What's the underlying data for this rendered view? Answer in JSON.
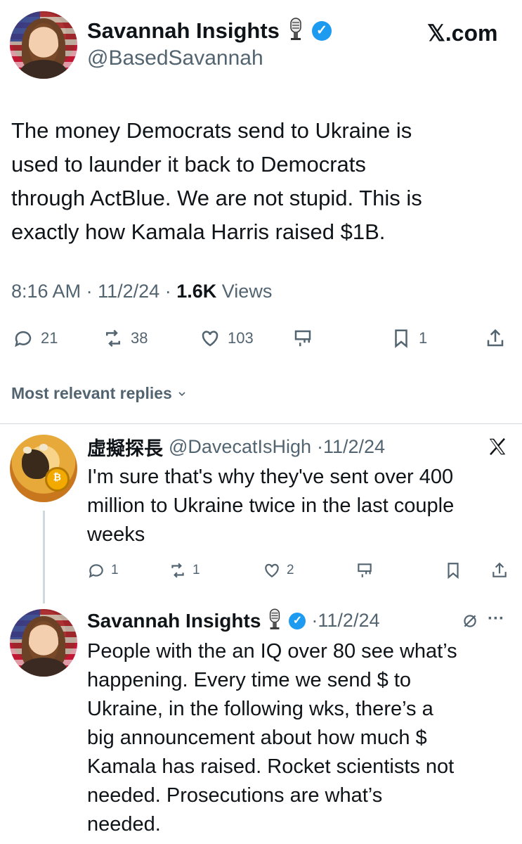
{
  "brand": {
    "label": "𝕏.com"
  },
  "main_tweet": {
    "author": {
      "display_name": "Savannah Insights",
      "handle": "@BasedSavannah",
      "verified_icon": "verified-badge-icon",
      "emoji_icon": "microphone-icon"
    },
    "text_lines": [
      "The money Democrats send to Ukraine is",
      "used to launder it back to Democrats",
      "through ActBlue. We are not stupid. This is",
      "exactly how Kamala Harris raised $1B."
    ],
    "time": "8:16 AM",
    "date": "11/2/24",
    "views_count": "1.6K",
    "views_label": "Views",
    "sep": "·",
    "actions": {
      "replies": "21",
      "reposts": "38",
      "likes": "103",
      "bookmarks": "1"
    }
  },
  "replies_section": {
    "label": "Most relevant replies",
    "chevron_icon": "chevron-down-icon"
  },
  "reply_1": {
    "display_name": "虛擬探長",
    "handle": "@DavecatIsHigh",
    "date": "·11/2/24",
    "platform_icon": "x-logo-icon",
    "text_lines": [
      "I'm sure that's why they've sent over 400",
      "million to Ukraine twice in the last couple",
      "weeks"
    ],
    "actions": {
      "replies": "1",
      "reposts": "1",
      "likes": "2"
    }
  },
  "reply_2": {
    "display_name": "Savannah Insights",
    "date": "·11/2/24",
    "more_label": "···",
    "text_lines": [
      "People with the an IQ over 80 see what’s",
      "happening. Every time we send $ to",
      "Ukraine, in the following wks, there’s a",
      "big announcement about how much $",
      "Kamala has raised. Rocket scientists not",
      "needed. Prosecutions are what’s",
      "needed."
    ]
  },
  "colors": {
    "accent": "#1d9bf0",
    "muted": "#536471",
    "text": "#0f1419",
    "divider": "#cfd9de"
  }
}
